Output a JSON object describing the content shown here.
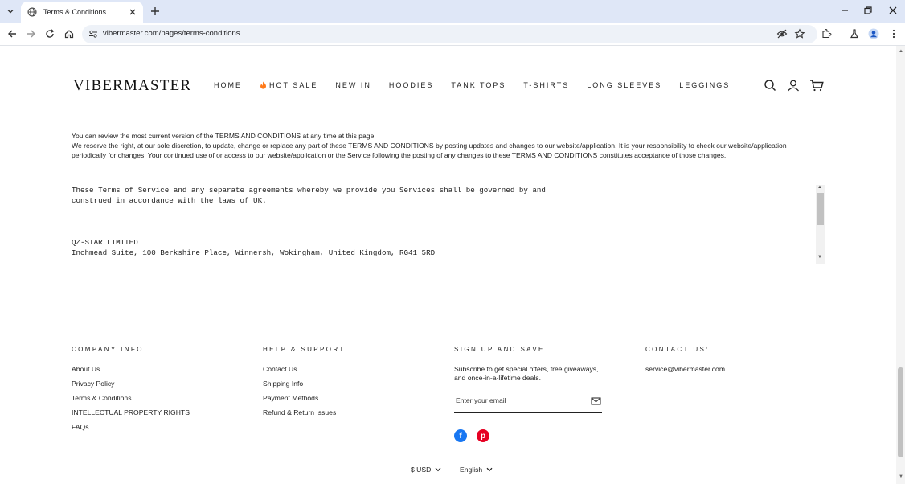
{
  "browser": {
    "tab_title": "Terms & Conditions",
    "url": "vibermaster.com/pages/terms-conditions"
  },
  "header": {
    "logo": "VIBERMASTER",
    "nav": [
      "HOME",
      "HOT SALE",
      "NEW IN",
      "HOODIES",
      "TANK TOPS",
      "T-SHIRTS",
      "LONG SLEEVES",
      "LEGGINGS"
    ]
  },
  "legal": {
    "para1": "You can review the most current version of the TERMS AND CONDITIONS at any time at this page.",
    "para2": "We reserve the right, at our sole discretion, to update, change or replace any part of these TERMS AND CONDITIONS by posting updates and changes to our website/application. It is your responsibility to check our website/application periodically for changes. Your continued use of or access to our website/application or the Service following the posting of any changes to these TERMS AND CONDITIONS constitutes acceptance of those changes."
  },
  "prebox": {
    "line1": "These Terms of Service and any separate agreements whereby we provide you Services shall be governed by and",
    "line2": "construed in accordance with the laws of UK.",
    "line3": "QZ-STAR LIMITED",
    "line4": "Inchmead Suite, 100 Berkshire Place, Winnersh, Wokingham, United Kingdom, RG41 5RD"
  },
  "footer": {
    "company": {
      "heading": "COMPANY INFO",
      "links": [
        "About Us",
        "Privacy Policy",
        "Terms & Conditions",
        "INTELLECTUAL PROPERTY RIGHTS",
        "FAQs"
      ]
    },
    "help": {
      "heading": "HELP & SUPPORT",
      "links": [
        "Contact Us",
        "Shipping Info",
        "Payment Methods",
        "Refund & Return Issues"
      ]
    },
    "signup": {
      "heading": "SIGN UP AND SAVE",
      "text": "Subscribe to get special offers, free giveaways, and once-in-a-lifetime deals.",
      "placeholder": "Enter your email"
    },
    "contact": {
      "heading": "CONTACT US:",
      "email": "service@vibermaster.com"
    },
    "currency": "$ USD",
    "language": "English"
  },
  "colors": {
    "tabbar_bg": "#dfe7f7",
    "facebook": "#1877f2",
    "pinterest": "#e60023",
    "flame": "#ff7a1a"
  }
}
